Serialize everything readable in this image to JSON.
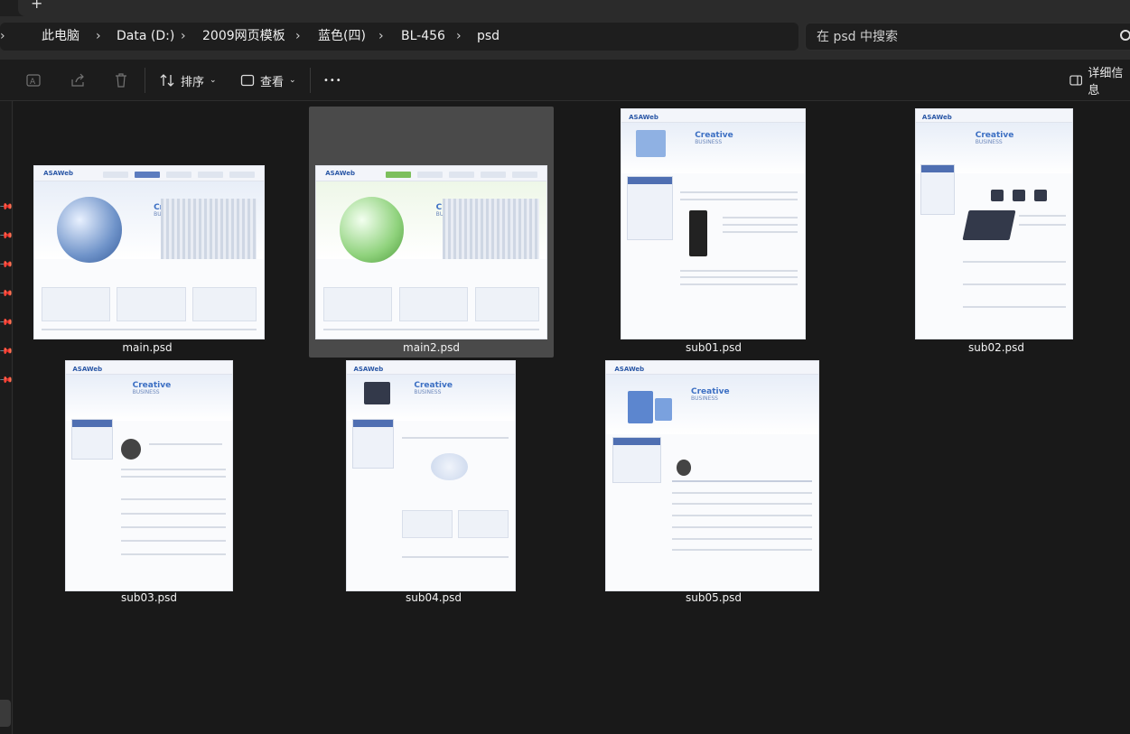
{
  "tabstrip": {
    "new_tab_glyph": "+"
  },
  "breadcrumb": {
    "items": [
      "此电脑",
      "Data (D:)",
      "2009网页模板",
      "蓝色(四)",
      "BL-456",
      "psd"
    ]
  },
  "search": {
    "placeholder": "在 psd 中搜索"
  },
  "toolbar": {
    "sort_label": "排序",
    "view_label": "查看",
    "more_label": "•••",
    "details_label": "详细信息"
  },
  "files": [
    {
      "name": "main.psd",
      "title": "Creative",
      "subtitle": "BUSINESS",
      "logo": "ASAWeb",
      "selected": false
    },
    {
      "name": "main2.psd",
      "title": "Creative",
      "subtitle": "BUSINESS",
      "logo": "ASAWeb",
      "selected": true
    },
    {
      "name": "sub01.psd",
      "title": "Creative",
      "subtitle": "BUSINESS",
      "logo": "ASAWeb",
      "selected": false
    },
    {
      "name": "sub02.psd",
      "title": "Creative",
      "subtitle": "BUSINESS",
      "logo": "ASAWeb",
      "selected": false
    },
    {
      "name": "sub03.psd",
      "title": "Creative",
      "subtitle": "BUSINESS",
      "logo": "ASAWeb",
      "selected": false
    },
    {
      "name": "sub04.psd",
      "title": "Creative",
      "subtitle": "BUSINESS",
      "logo": "ASAWeb",
      "selected": false
    },
    {
      "name": "sub05.psd",
      "title": "Creative",
      "subtitle": "BUSINESS",
      "logo": "ASAWeb",
      "selected": false
    }
  ],
  "colors": {
    "accent": "#5c7cbf",
    "background": "#191919",
    "selection": "#4a4a4a"
  }
}
